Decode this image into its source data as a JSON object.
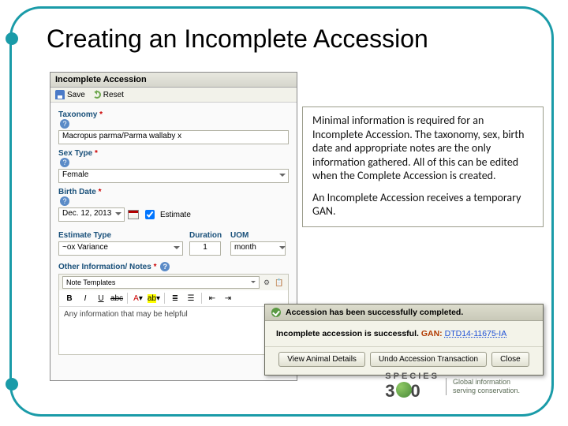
{
  "slide": {
    "title": "Creating an Incomplete Accession"
  },
  "form": {
    "panel_title": "Incomplete Accession",
    "save_label": "Save",
    "reset_label": "Reset",
    "taxonomy_label": "Taxonomy",
    "taxonomy_value": "Macropus parma/Parma wallaby  x",
    "sex_label": "Sex Type",
    "sex_value": "Female",
    "birth_label": "Birth Date",
    "birth_value": "Dec. 12, 2013",
    "estimate_label": "Estimate",
    "est_type_label": "Estimate Type",
    "est_type_value": "~ox Variance",
    "duration_label": "Duration",
    "duration_value": "1",
    "uom_label": "UOM",
    "uom_value": "month",
    "notes_label": "Other Information/ Notes",
    "note_template_text": "Note Templates",
    "notes_value": "Any information that may be helpful"
  },
  "annotation": {
    "p1": "Minimal information is required for an Incomplete Accession. The taxonomy, sex, birth date and appropriate notes are the only information gathered. All of this can be edited when the Complete Accession is created.",
    "p2": "An Incomplete Accession receives a temporary GAN."
  },
  "success": {
    "header": "Accession has been successfully completed.",
    "body_prefix": "Incomplete accession is successful.",
    "gan_label": "GAN:",
    "gan_value": "DTD14-11675-IA",
    "btn_details": "View Animal Details",
    "btn_undo": "Undo Accession Transaction",
    "btn_close": "Close"
  },
  "footer": {
    "brand": "SPECIES",
    "three": "3",
    "zero": "0",
    "tagline1": "Global information",
    "tagline2": "serving conservation."
  }
}
